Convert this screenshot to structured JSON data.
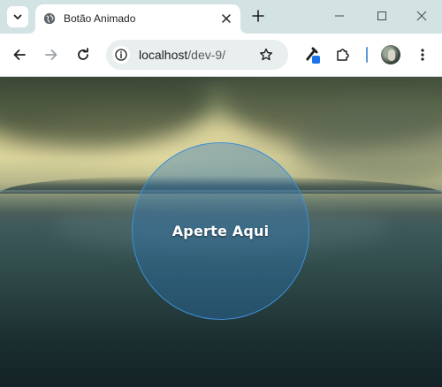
{
  "browser": {
    "tab": {
      "title": "Botão Animado",
      "favicon": "globe-icon"
    },
    "omnibox": {
      "host": "localhost",
      "path": "/dev-9/"
    },
    "icons": {
      "tab_search": "chevron-down-icon",
      "tab_close": "close-icon",
      "new_tab": "plus-icon",
      "minimize": "minimize-icon",
      "maximize": "maximize-icon",
      "window_close": "close-icon",
      "back": "arrow-left-icon",
      "forward": "arrow-right-icon",
      "reload": "reload-icon",
      "site_info": "info-icon",
      "bookmark": "star-icon",
      "extension_tool": "eyedropper-icon",
      "extensions": "puzzle-icon",
      "profile": "avatar",
      "menu": "more-vertical-icon"
    },
    "colors": {
      "tabstrip": "#d3e3e3",
      "toolbar": "#ffffff",
      "omnibox": "#e9eeee",
      "accent": "#3f8fd6"
    }
  },
  "page": {
    "button_label": "Aperte Aqui",
    "colors": {
      "button_fill": "rgba(45,120,190,0.38)",
      "button_border": "#3f8fd6",
      "button_text": "#ffffff"
    }
  }
}
